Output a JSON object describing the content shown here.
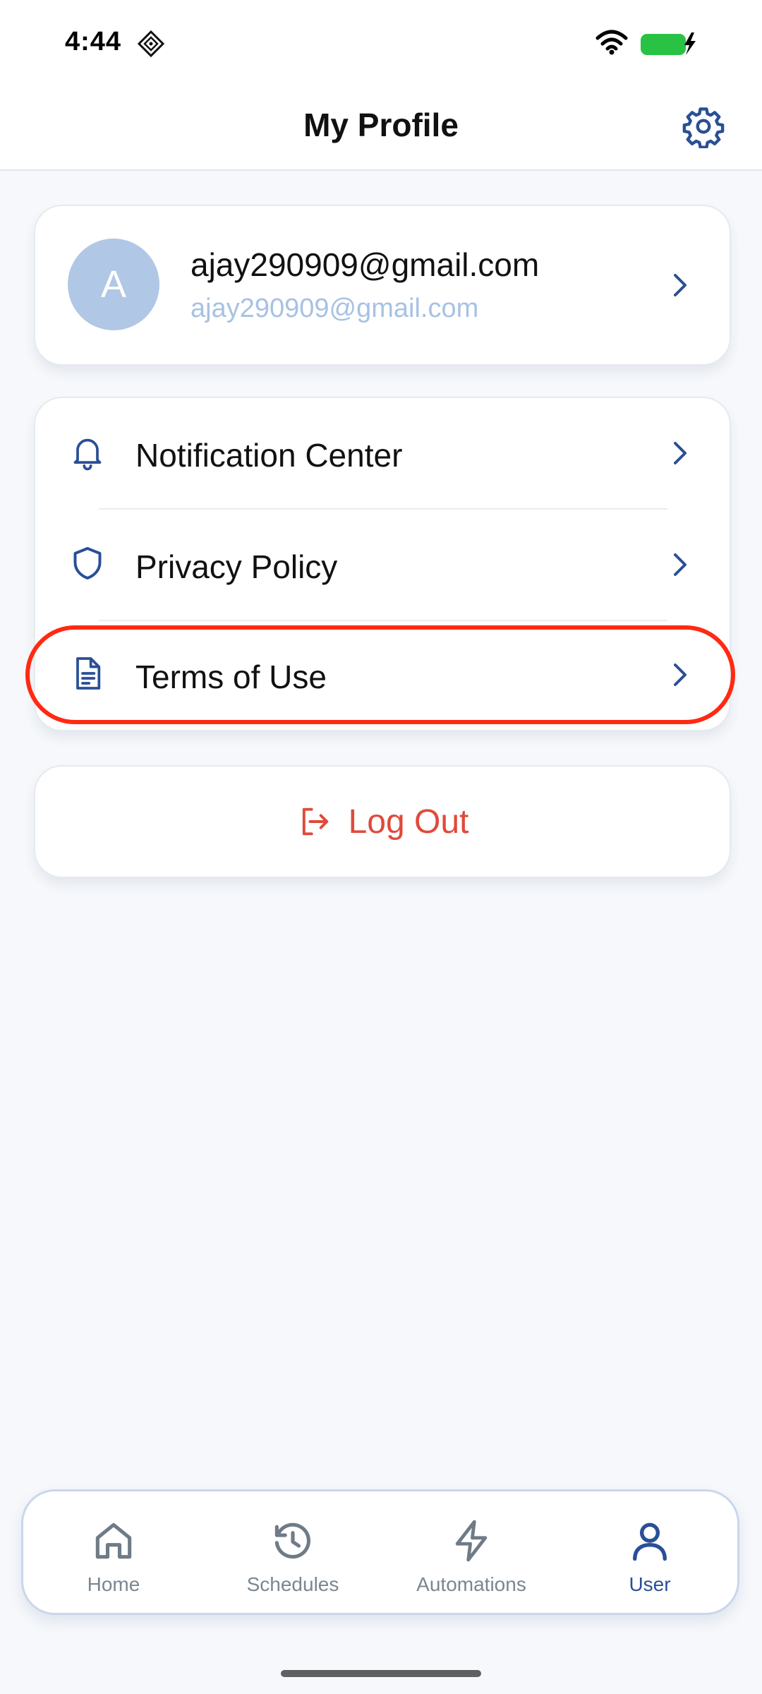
{
  "status_bar": {
    "time": "4:44"
  },
  "header": {
    "title": "My Profile",
    "settings_icon": "gear-icon"
  },
  "profile": {
    "avatar_letter": "A",
    "email": "ajay290909@gmail.com",
    "subtitle": "ajay290909@gmail.com"
  },
  "menu": {
    "items": [
      {
        "label": "Notification Center",
        "icon": "bell-icon"
      },
      {
        "label": "Privacy Policy",
        "icon": "shield-icon"
      },
      {
        "label": "Terms of Use",
        "icon": "document-icon"
      }
    ]
  },
  "logout": {
    "label": "Log Out",
    "icon": "logout-icon"
  },
  "tabs": [
    {
      "label": "Home",
      "icon": "home-icon",
      "active": false
    },
    {
      "label": "Schedules",
      "icon": "history-icon",
      "active": false
    },
    {
      "label": "Automations",
      "icon": "lightning-icon",
      "active": false
    },
    {
      "label": "User",
      "icon": "user-icon",
      "active": true
    }
  ],
  "colors": {
    "accent": "#2a4f96",
    "logout": "#e04a3a",
    "avatar_bg": "#b0c7e5",
    "highlight": "#ff2a12",
    "background": "#f6f8fb"
  }
}
